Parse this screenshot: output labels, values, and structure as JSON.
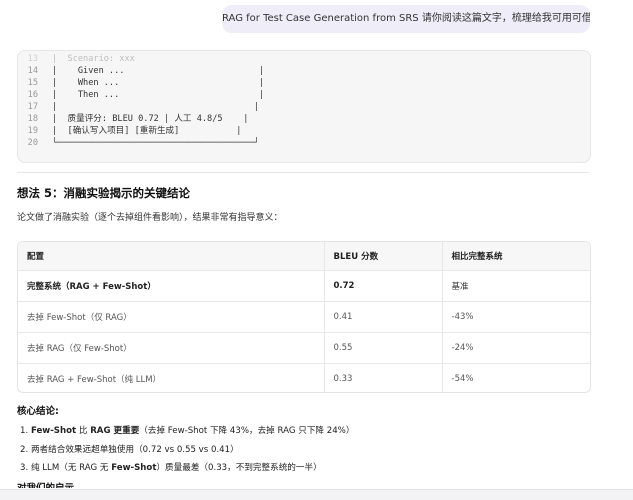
{
  "user_message": "RAG for Test Case Generation from SRS 请你阅读这篇文字，梳理给我可用可借鉴的想法",
  "code_lines": [
    {
      "n": "13",
      "text": "|  Scenario: xxx"
    },
    {
      "n": "14",
      "text": "|    Given ...                          |"
    },
    {
      "n": "15",
      "text": "|    When ...                           |"
    },
    {
      "n": "16",
      "text": "|    Then ...                           |"
    },
    {
      "n": "17",
      "text": "|                                      |"
    },
    {
      "n": "18",
      "text": "|  质量评分: BLEU 0.72 | 人工 4.8/5    |"
    },
    {
      "n": "19",
      "text": "|  [确认写入项目] [重新生成]           |"
    },
    {
      "n": "20",
      "text": "└──────────────────────────────────────┘"
    }
  ],
  "section": {
    "heading": "想法 5：消融实验揭示的关键结论",
    "intro": "论文做了消融实验（逐个去掉组件看影响），结果非常有指导意义："
  },
  "table": {
    "headers": [
      "配置",
      "BLEU 分数",
      "相比完整系统"
    ],
    "rows": [
      [
        "完整系统（RAG + Few-Shot）",
        "0.72",
        "基准"
      ],
      [
        "去掉 Few-Shot（仅 RAG）",
        "0.41",
        "-43%"
      ],
      [
        "去掉 RAG（仅 Few-Shot）",
        "0.55",
        "-24%"
      ],
      [
        "去掉 RAG + Few-Shot（纯 LLM）",
        "0.33",
        "-54%"
      ]
    ]
  },
  "conclusions": {
    "title": "核心结论:",
    "item1_bold": "Few-Shot",
    "item1_mid": " 比 ",
    "item1_bold2": "RAG 更重要",
    "item1_rest": "（去掉 Few-Shot 下降 43%，去掉 RAG 只下降 24%）",
    "item2": "两者结合效果远超单独使用（0.72 vs 0.55 vs 0.41）",
    "item3_pre": "纯 LLM（无 RAG 无 ",
    "item3_bold": "Few-Shot",
    "item3_rest": "）质量最差（0.33，不到完整系统的一半）"
  },
  "next_heading_partial": "对我们的启示"
}
